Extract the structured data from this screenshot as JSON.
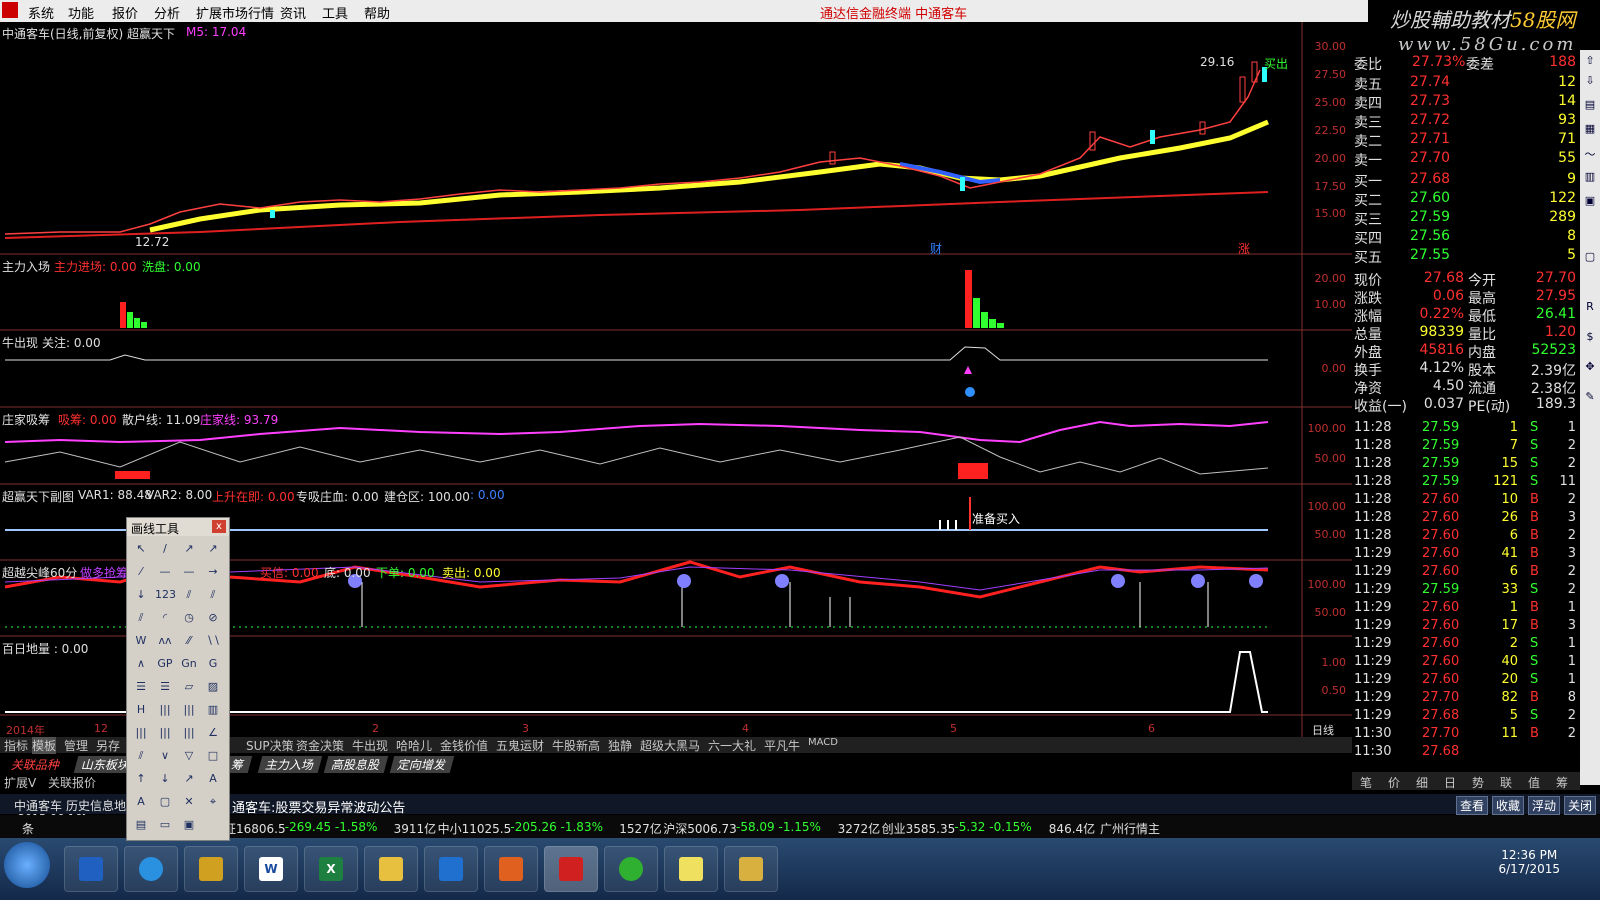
{
  "menu": {
    "items": [
      "系统",
      "功能",
      "报价",
      "分析",
      "扩展市场行情",
      "资讯",
      "工具",
      "帮助"
    ],
    "center_title": "通达信金融终端    中通客车"
  },
  "watermark": {
    "line1_a": "炒股輔助教材",
    "line1_b": "58股网",
    "line2": "www.58Gu.com"
  },
  "main_chart": {
    "title": "中通客车(日线,前复权) 超赢天下",
    "ma_label": "M5: 17.04",
    "high_label": "29.16",
    "low_label": "12.72",
    "buy_marker": "买出",
    "cai_marker": "财",
    "zhang_marker": "涨",
    "y_ticks": [
      "30.00",
      "27.50",
      "25.00",
      "22.50",
      "20.00",
      "17.50",
      "15.00"
    ]
  },
  "panel_zljc": {
    "title": "主力入场",
    "items": [
      {
        "label": "主力进场: 0.00",
        "color": "#ff3030"
      },
      {
        "label": "洗盘: 0.00",
        "color": "#30ff30"
      }
    ],
    "y_ticks": [
      "20.00",
      "10.00"
    ]
  },
  "panel_nzc": {
    "title": "牛出现",
    "items": [
      {
        "label": "关注: 0.00",
        "color": "#e0e0e0"
      }
    ],
    "y_ticks": [
      "0.00"
    ]
  },
  "panel_zjxc": {
    "title": "庄家吸筹",
    "items": [
      {
        "label": "吸筹: 0.00",
        "color": "#ff3030"
      },
      {
        "label": "散户线: 11.09",
        "color": "#e0e0e0"
      },
      {
        "label": "庄家线: 93.79",
        "color": "#ff40ff"
      }
    ],
    "y_ticks": [
      "100.00",
      "50.00"
    ]
  },
  "panel_cytx": {
    "title": "超赢天下副图",
    "items": [
      {
        "label": "VAR1: 88.48",
        "color": "#e0e0e0"
      },
      {
        "label": "VAR2: 8.00",
        "color": "#e0e0e0"
      },
      {
        "label": "上升在即: 0.00",
        "color": "#ff3030"
      },
      {
        "label": "专吸庄血: 0.00",
        "color": "#e0e0e0"
      },
      {
        "label": "建仓区: 100.00",
        "color": "#e0e0e0"
      },
      {
        "label": ": 0.00",
        "color": "#4080ff"
      }
    ],
    "annotation": "准备买入",
    "y_ticks": [
      "100.00",
      "50.00"
    ]
  },
  "panel_cyjf": {
    "title": "超越尖峰60分",
    "items": [
      {
        "label": "做多抢筹",
        "color": "#c040ff"
      },
      {
        "label": "买信: 0.00",
        "color": "#ff3030"
      },
      {
        "label": "底: 0.00",
        "color": "#e0e0e0"
      },
      {
        "label": "下单: 0.00",
        "color": "#30ff30"
      },
      {
        "label": "卖出: 0.00",
        "color": "#ffff30"
      }
    ],
    "y_ticks": [
      "100.00",
      "50.00"
    ]
  },
  "panel_brdl": {
    "title": "百日地量 : 0.00",
    "y_ticks": [
      "1.00",
      "0.50"
    ]
  },
  "time_axis": {
    "labels": [
      "2014年",
      "12",
      "2",
      "3",
      "4",
      "5",
      "6"
    ],
    "period": "日线"
  },
  "indicator_tabs": [
    "指标",
    "模板",
    "管理",
    "另存",
    "SUP决策",
    "资金决策",
    "牛出现",
    "哈哈儿",
    "金钱价值",
    "五鬼运财",
    "牛股新高",
    "独静",
    "超级大黑马",
    "六一大礼",
    "平凡牛",
    "MACD"
  ],
  "template_tabs": [
    "关联品种",
    "山东板块",
    "筹",
    "主力入场",
    "高股息股",
    "定向增发"
  ],
  "bottom_tabs": [
    "扩展V",
    "关联报价"
  ],
  "quote": {
    "header": {
      "label": "委比",
      "value": "27.73%",
      "label2": "委差",
      "value2": "188"
    },
    "asks": [
      {
        "label": "卖五",
        "price": "27.74",
        "vol": "12"
      },
      {
        "label": "卖四",
        "price": "27.73",
        "vol": "14"
      },
      {
        "label": "卖三",
        "price": "27.72",
        "vol": "93"
      },
      {
        "label": "卖二",
        "price": "27.71",
        "vol": "71"
      },
      {
        "label": "卖一",
        "price": "27.70",
        "vol": "55"
      }
    ],
    "bids": [
      {
        "label": "买一",
        "price": "27.68",
        "vol": "9"
      },
      {
        "label": "买二",
        "price": "27.60",
        "vol": "122"
      },
      {
        "label": "买三",
        "price": "27.59",
        "vol": "289"
      },
      {
        "label": "买四",
        "price": "27.56",
        "vol": "8"
      },
      {
        "label": "买五",
        "price": "27.55",
        "vol": "5"
      }
    ],
    "stats": [
      {
        "l1": "现价",
        "v1": "27.68",
        "l2": "今开",
        "v2": "27.70",
        "c1": "#ff3030",
        "c2": "#ff3030"
      },
      {
        "l1": "涨跌",
        "v1": "0.06",
        "l2": "最高",
        "v2": "27.95",
        "c1": "#ff3030",
        "c2": "#ff3030"
      },
      {
        "l1": "涨幅",
        "v1": "0.22%",
        "l2": "最低",
        "v2": "26.41",
        "c1": "#ff3030",
        "c2": "#30ff30"
      },
      {
        "l1": "总量",
        "v1": "98339",
        "l2": "量比",
        "v2": "1.20",
        "c1": "#ffff30",
        "c2": "#ff3030"
      },
      {
        "l1": "外盘",
        "v1": "45816",
        "l2": "内盘",
        "v2": "52523",
        "c1": "#ff3030",
        "c2": "#30ff30"
      },
      {
        "l1": "换手",
        "v1": "4.12%",
        "l2": "股本",
        "v2": "2.39亿",
        "c1": "#e0e0e0",
        "c2": "#e0e0e0"
      },
      {
        "l1": "净资",
        "v1": "4.50",
        "l2": "流通",
        "v2": "2.38亿",
        "c1": "#e0e0e0",
        "c2": "#e0e0e0"
      },
      {
        "l1": "收益(一)",
        "v1": "0.037",
        "l2": "PE(动)",
        "v2": "189.3",
        "c1": "#e0e0e0",
        "c2": "#e0e0e0"
      }
    ],
    "trades": [
      {
        "t": "11:28",
        "p": "27.59",
        "v": "1",
        "s": "S",
        "n": "1"
      },
      {
        "t": "11:28",
        "p": "27.59",
        "v": "7",
        "s": "S",
        "n": "2"
      },
      {
        "t": "11:28",
        "p": "27.59",
        "v": "15",
        "s": "S",
        "n": "2"
      },
      {
        "t": "11:28",
        "p": "27.59",
        "v": "121",
        "s": "S",
        "n": "11"
      },
      {
        "t": "11:28",
        "p": "27.60",
        "v": "10",
        "s": "B",
        "n": "2"
      },
      {
        "t": "11:28",
        "p": "27.60",
        "v": "26",
        "s": "B",
        "n": "3"
      },
      {
        "t": "11:28",
        "p": "27.60",
        "v": "6",
        "s": "B",
        "n": "2"
      },
      {
        "t": "11:29",
        "p": "27.60",
        "v": "41",
        "s": "B",
        "n": "3"
      },
      {
        "t": "11:29",
        "p": "27.60",
        "v": "6",
        "s": "B",
        "n": "2"
      },
      {
        "t": "11:29",
        "p": "27.59",
        "v": "33",
        "s": "S",
        "n": "2"
      },
      {
        "t": "11:29",
        "p": "27.60",
        "v": "1",
        "s": "B",
        "n": "1"
      },
      {
        "t": "11:29",
        "p": "27.60",
        "v": "17",
        "s": "B",
        "n": "3"
      },
      {
        "t": "11:29",
        "p": "27.60",
        "v": "2",
        "s": "S",
        "n": "1"
      },
      {
        "t": "11:29",
        "p": "27.60",
        "v": "40",
        "s": "S",
        "n": "1"
      },
      {
        "t": "11:29",
        "p": "27.60",
        "v": "20",
        "s": "S",
        "n": "1"
      },
      {
        "t": "11:29",
        "p": "27.70",
        "v": "82",
        "s": "B",
        "n": "8"
      },
      {
        "t": "11:29",
        "p": "27.68",
        "v": "5",
        "s": "S",
        "n": "2"
      },
      {
        "t": "11:30",
        "p": "27.70",
        "v": "11",
        "s": "B",
        "n": "2"
      },
      {
        "t": "11:30",
        "p": "27.68",
        "v": "",
        "s": "",
        "n": ""
      }
    ],
    "bottom_tabs": [
      "笔",
      "价",
      "细",
      "日",
      "势",
      "联",
      "值",
      "筹"
    ]
  },
  "news": {
    "stock": "中通客车",
    "tab": "历史信息地",
    "date": "2015-06-16[",
    "headline": "通客车:股票交易异常波动公告",
    "buttons": [
      "查看",
      "收藏",
      "浮动",
      "关闭"
    ]
  },
  "ticker": {
    "items": [
      {
        "text": "4596亿",
        "color": "#e0e0e0"
      },
      {
        "text": "深证16806.5",
        "color": "#e0e0e0"
      },
      {
        "text": "-269.45 -1.58%",
        "color": "#30ff30"
      },
      {
        "text": "3911亿",
        "color": "#e0e0e0"
      },
      {
        "text": "中小11025.5",
        "color": "#e0e0e0"
      },
      {
        "text": "-205.26 -1.83%",
        "color": "#30ff30"
      },
      {
        "text": "1527亿",
        "color": "#e0e0e0"
      },
      {
        "text": "沪深5006.73",
        "color": "#e0e0e0"
      },
      {
        "text": "-58.09 -1.15%",
        "color": "#30ff30"
      },
      {
        "text": "3272亿",
        "color": "#e0e0e0"
      },
      {
        "text": "创业3585.35",
        "color": "#e0e0e0"
      },
      {
        "text": "-5.32 -0.15%",
        "color": "#30ff30"
      },
      {
        "text": "846.4亿",
        "color": "#e0e0e0"
      },
      {
        "text": "广州行情主",
        "color": "#e0e0e0"
      }
    ],
    "left_label": "条"
  },
  "drawtool": {
    "title": "画线工具",
    "close": "x"
  },
  "taskbar": {
    "time": "12:36 PM",
    "date": "6/17/2015",
    "word_label": "W",
    "excel_label": "X"
  }
}
